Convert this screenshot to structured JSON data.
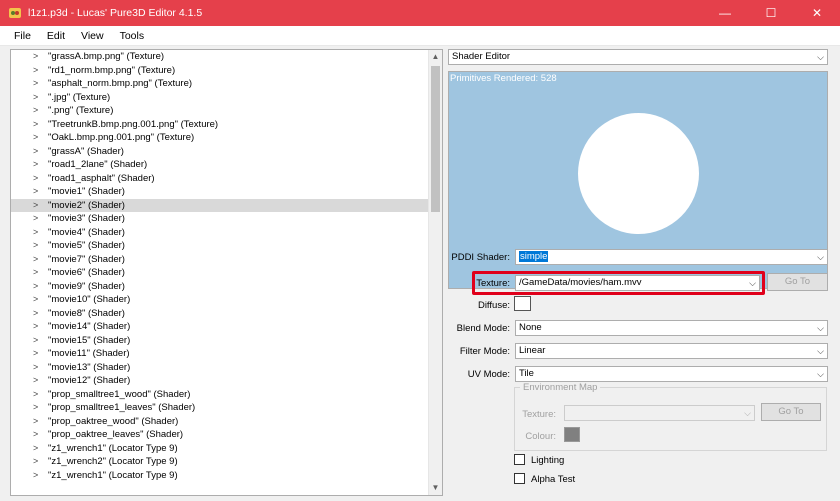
{
  "window": {
    "title": "l1z1.p3d - Lucas' Pure3D Editor 4.1.5",
    "minimize_glyph": "—",
    "maximize_glyph": "☐",
    "close_glyph": "✕"
  },
  "menu": [
    "File",
    "Edit",
    "View",
    "Tools"
  ],
  "tree": {
    "expander_glyph": ">",
    "selected_index": 11,
    "items": [
      "\"grassA.bmp.png\" (Texture)",
      "\"rd1_norm.bmp.png\" (Texture)",
      "\"asphalt_norm.bmp.png\" (Texture)",
      "\".jpg\" (Texture)",
      "\".png\" (Texture)",
      "\"TreetrunkB.bmp.png.001.png\" (Texture)",
      "\"OakL.bmp.png.001.png\" (Texture)",
      "\"grassA\" (Shader)",
      "\"road1_2lane\" (Shader)",
      "\"road1_asphalt\" (Shader)",
      "\"movie1\" (Shader)",
      "\"movie2\" (Shader)",
      "\"movie3\" (Shader)",
      "\"movie4\" (Shader)",
      "\"movie5\" (Shader)",
      "\"movie7\" (Shader)",
      "\"movie6\" (Shader)",
      "\"movie9\" (Shader)",
      "\"movie10\" (Shader)",
      "\"movie8\" (Shader)",
      "\"movie14\" (Shader)",
      "\"movie15\" (Shader)",
      "\"movie11\" (Shader)",
      "\"movie13\" (Shader)",
      "\"movie12\" (Shader)",
      "\"prop_smalltree1_wood\" (Shader)",
      "\"prop_smalltree1_leaves\" (Shader)",
      "\"prop_oaktree_wood\" (Shader)",
      "\"prop_oaktree_leaves\" (Shader)",
      "\"z1_wrench1\" (Locator Type 9)",
      "\"z1_wrench2\" (Locator Type 9)",
      "\"z1_wrench1\" (Locator Type 9)"
    ]
  },
  "editor": {
    "selector": "Shader Editor",
    "preview_text": "Primitives Rendered: 528",
    "preview_bg": "#9fc5e0",
    "pddi_label": "PDDI Shader:",
    "pddi_value": "simple",
    "texture_label": "Texture:",
    "texture_value": "/GameData/movies/ham.mvv",
    "goto_label": "Go To",
    "diffuse_label": "Diffuse:",
    "blend_label": "Blend Mode:",
    "blend_value": "None",
    "filter_label": "Filter Mode:",
    "filter_value": "Linear",
    "uv_label": "UV Mode:",
    "uv_value": "Tile",
    "env_title": "Environment Map",
    "env_texture_label": "Texture:",
    "env_texture_value": "",
    "env_goto_label": "Go To",
    "env_colour_label": "Colour:",
    "lighting_label": "Lighting",
    "alpha_label": "Alpha Test",
    "highlight_color": "#e0001b",
    "dropdown_glyph": "⌵"
  }
}
